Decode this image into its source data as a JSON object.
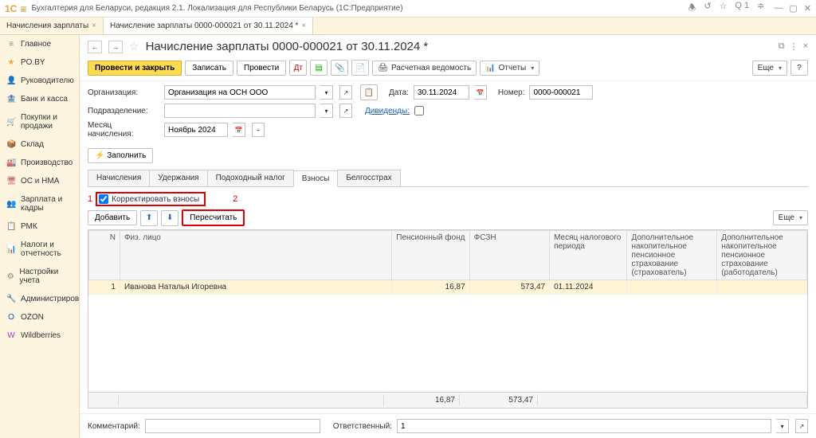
{
  "app": {
    "logo": "1C",
    "title": "Бухгалтерия для Беларуси, редакция 2.1. Локализация для Республики Беларусь  (1С:Предприятие)",
    "badge": "1"
  },
  "tabs": [
    {
      "label": "Начисления зарплаты"
    },
    {
      "label": "Начисление зарплаты 0000-000021 от 30.11.2024 *"
    }
  ],
  "sidebar": [
    {
      "icon": "≡",
      "color": "#888",
      "label": "Главное"
    },
    {
      "icon": "★",
      "color": "#e8a33d",
      "label": "PO.BY"
    },
    {
      "icon": "👤",
      "color": "#888",
      "label": "Руководителю"
    },
    {
      "icon": "🏦",
      "color": "#5a9",
      "label": "Банк и касса"
    },
    {
      "icon": "🛒",
      "color": "#5a9",
      "label": "Покупки и продажи"
    },
    {
      "icon": "📦",
      "color": "#c99",
      "label": "Склад"
    },
    {
      "icon": "🏭",
      "color": "#888",
      "label": "Производство"
    },
    {
      "icon": "🖥",
      "color": "#c77",
      "label": "ОС и НМА"
    },
    {
      "icon": "👥",
      "color": "#7a9",
      "label": "Зарплата и кадры"
    },
    {
      "icon": "📋",
      "color": "#99c",
      "label": "РМК"
    },
    {
      "icon": "📊",
      "color": "#c88",
      "label": "Налоги и отчетность"
    },
    {
      "icon": "⚙",
      "color": "#888",
      "label": "Настройки учета"
    },
    {
      "icon": "🔧",
      "color": "#888",
      "label": "Администрирование"
    },
    {
      "icon": "O",
      "color": "#15b",
      "label": "OZON"
    },
    {
      "icon": "W",
      "color": "#a3c",
      "label": "Wildberries"
    }
  ],
  "doc": {
    "title": "Начисление зарплаты 0000-000021 от 30.11.2024 *",
    "toolbar": {
      "post_close": "Провести и закрыть",
      "save": "Записать",
      "post": "Провести",
      "print": "Расчетная ведомость",
      "reports": "Отчеты",
      "more": "Еще"
    },
    "form": {
      "org_label": "Организация:",
      "org_value": "Организация на ОСН ООО",
      "date_label": "Дата:",
      "date_value": "30.11.2024",
      "num_label": "Номер:",
      "num_value": "0000-000021",
      "dept_label": "Подразделение:",
      "dept_value": "",
      "div_label": "Дивиденды:",
      "month_label": "Месяц начисления:",
      "month_value": "Ноябрь 2024",
      "fill": "Заполнить"
    },
    "inner_tabs": [
      "Начисления",
      "Удержания",
      "Подоходный налог",
      "Взносы",
      "Белгосстрах"
    ],
    "correct": {
      "num1": "1",
      "label": "Корректировать взносы",
      "num2": "2"
    },
    "sub_toolbar": {
      "add": "Добавить",
      "recalc": "Пересчитать",
      "more": "Еще"
    },
    "table": {
      "headers": [
        "N",
        "Физ. лицо",
        "Пенсионный фонд",
        "ФСЗН",
        "Месяц налогового периода",
        "Дополнительное накопительное пенсионное страхование (страхователь)",
        "Дополнительное накопительное пенсионное страхование (работодатель)"
      ],
      "row": {
        "n": "1",
        "name": "Иванова Наталья Игоревна",
        "pf": "16,87",
        "fszn": "573,47",
        "month": "01.11.2024"
      },
      "totals": {
        "pf": "16,87",
        "fszn": "573,47"
      }
    },
    "comment": {
      "label": "Комментарий:",
      "resp_label": "Ответственный:",
      "resp_value": "1"
    }
  }
}
